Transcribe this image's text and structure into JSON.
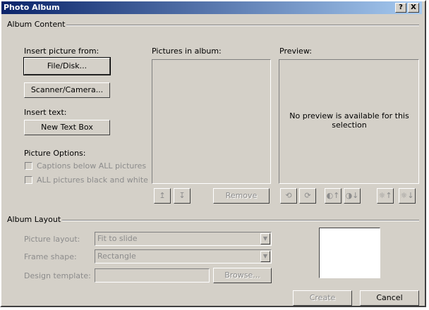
{
  "window": {
    "title": "Photo Album",
    "help_button": "?",
    "close_button": "X"
  },
  "album_content": {
    "group_label": "Album Content",
    "insert_picture_from": "Insert picture from:",
    "file_disk_button": "File/Disk...",
    "scanner_camera_button": "Scanner/Camera...",
    "insert_text": "Insert text:",
    "new_text_box_button": "New Text Box",
    "picture_options": "Picture Options:",
    "captions_checkbox": "Captions below ALL pictures",
    "bw_checkbox": "ALL pictures black and white",
    "pictures_in_album": "Pictures in album:",
    "preview_label": "Preview:",
    "preview_message": "No preview is available for this selection",
    "move_up_icon": "↥",
    "move_down_icon": "↧",
    "remove_button": "Remove",
    "rotate_left_icon": "⟲",
    "rotate_right_icon": "⟳",
    "contrast_up_icon": "◐↑",
    "contrast_down_icon": "◑↓",
    "brightness_up_icon": "☼↑",
    "brightness_down_icon": "☼↓"
  },
  "album_layout": {
    "group_label": "Album Layout",
    "picture_layout_label": "Picture layout:",
    "picture_layout_value": "Fit to slide",
    "frame_shape_label": "Frame shape:",
    "frame_shape_value": "Rectangle",
    "design_template_label": "Design template:",
    "design_template_value": "",
    "browse_button": "Browse..."
  },
  "footer": {
    "create_button": "Create",
    "cancel_button": "Cancel"
  },
  "colors": {
    "title_start": "#0a246a",
    "title_end": "#a6caf0",
    "face": "#d4d0c8"
  }
}
